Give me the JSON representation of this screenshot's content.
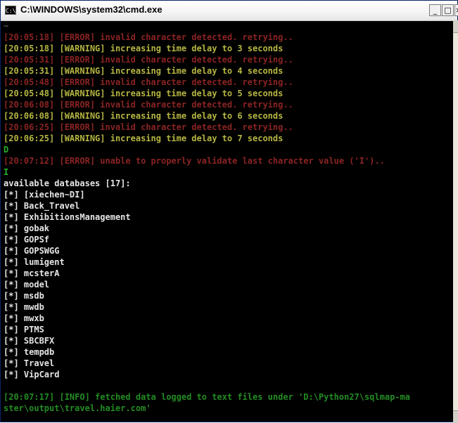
{
  "window": {
    "title": "C:\\WINDOWS\\system32\\cmd.exe",
    "icon_label": "C:\\",
    "minimize": "_",
    "maximize": "□",
    "close": "×"
  },
  "console": {
    "lines": [
      {
        "text": "~",
        "color": "#5c5c5c"
      },
      {
        "text": "[20:05:18] [ERROR] invalid character detected. retrying..",
        "color": "#8b2323"
      },
      {
        "text": "[20:05:18] [WARNING] increasing time delay to 3 seconds",
        "color": "#b5b542"
      },
      {
        "text": "[20:05:31] [ERROR] invalid character detected. retrying..",
        "color": "#8b2323"
      },
      {
        "text": "[20:05:31] [WARNING] increasing time delay to 4 seconds",
        "color": "#b5b542"
      },
      {
        "text": "[20:05:48] [ERROR] invalid character detected. retrying..",
        "color": "#8b2323"
      },
      {
        "text": "[20:05:48] [WARNING] increasing time delay to 5 seconds",
        "color": "#b5b542"
      },
      {
        "text": "[20:06:08] [ERROR] invalid character detected. retrying..",
        "color": "#8b2323"
      },
      {
        "text": "[20:06:08] [WARNING] increasing time delay to 6 seconds",
        "color": "#b5b542"
      },
      {
        "text": "[20:06:25] [ERROR] invalid character detected. retrying..",
        "color": "#8b2323"
      },
      {
        "text": "[20:06:25] [WARNING] increasing time delay to 7 seconds",
        "color": "#b5b542"
      },
      {
        "text": "D",
        "color": "#2bb12b"
      },
      {
        "text": "[20:07:12] [ERROR] unable to properly validate last character value ('I')..",
        "color": "#8b2323"
      },
      {
        "text": "I",
        "color": "#2bb12b"
      },
      {
        "text": "available databases [17]:",
        "color": "#e6e6e6"
      },
      {
        "text": "[*] [xiechen~DI]",
        "color": "#e6e6e6"
      },
      {
        "text": "[*] Back_Travel",
        "color": "#e6e6e6"
      },
      {
        "text": "[*] ExhibitionsManagement",
        "color": "#e6e6e6"
      },
      {
        "text": "[*] gobak",
        "color": "#e6e6e6"
      },
      {
        "text": "[*] GOPSf",
        "color": "#e6e6e6"
      },
      {
        "text": "[*] GOPSWGG",
        "color": "#e6e6e6"
      },
      {
        "text": "[*] lumigent",
        "color": "#e6e6e6"
      },
      {
        "text": "[*] mcsterA",
        "color": "#e6e6e6"
      },
      {
        "text": "[*] model",
        "color": "#e6e6e6"
      },
      {
        "text": "[*] msdb",
        "color": "#e6e6e6"
      },
      {
        "text": "[*] mwdb",
        "color": "#e6e6e6"
      },
      {
        "text": "[*] mwxb",
        "color": "#e6e6e6"
      },
      {
        "text": "[*] PTMS",
        "color": "#e6e6e6"
      },
      {
        "text": "[*] SBCBFX",
        "color": "#e6e6e6"
      },
      {
        "text": "[*] tempdb",
        "color": "#e6e6e6"
      },
      {
        "text": "[*] Travel",
        "color": "#e6e6e6"
      },
      {
        "text": "[*] VipCard",
        "color": "#e6e6e6"
      },
      {
        "text": "",
        "color": "#e6e6e6"
      },
      {
        "text": "[20:07:17] [INFO] fetched data logged to text files under 'D:\\Python27\\sqlmap-ma",
        "color": "#238c23"
      },
      {
        "text": "ster\\output\\travel.haier.com'",
        "color": "#238c23"
      }
    ]
  }
}
